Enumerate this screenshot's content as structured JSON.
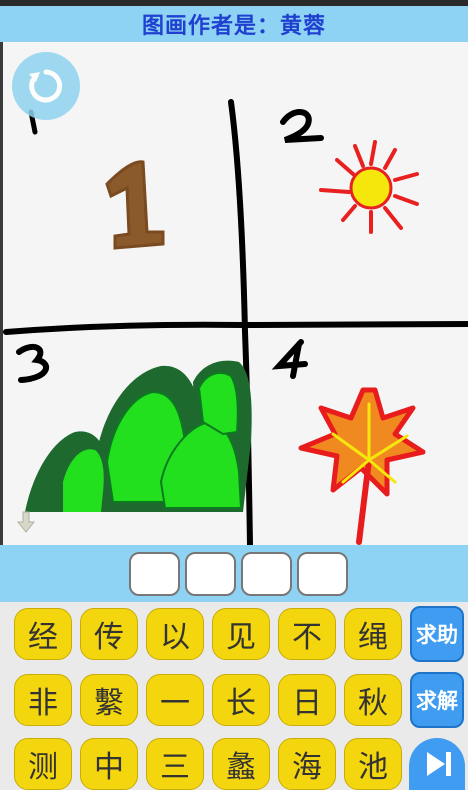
{
  "header": {
    "title": "图画作者是：黄蓉"
  },
  "canvas": {
    "quadrant_numbers": [
      "1",
      "2",
      "3",
      "4"
    ],
    "drawings": [
      "number-one",
      "sun",
      "green-mountains",
      "red-maple-leaf"
    ]
  },
  "answer": {
    "slots": [
      "",
      "",
      "",
      ""
    ]
  },
  "keyboard": {
    "rows": [
      [
        "经",
        "传",
        "以",
        "见",
        "不",
        "绳"
      ],
      [
        "非",
        "繫",
        "一",
        "长",
        "日",
        "秋"
      ],
      [
        "测",
        "中",
        "三",
        "蠡",
        "海",
        "池"
      ]
    ],
    "hint_label": "求助",
    "solve_label": "求解"
  },
  "colors": {
    "title_bar": "#8fd3f4",
    "title_text": "#2040d0",
    "key_yellow": "#f4d60e",
    "side_button_blue": "#3f9cf0"
  },
  "icons": {
    "replay": "replay-icon",
    "down_arrow": "down-arrow-icon",
    "next": "next-icon"
  }
}
